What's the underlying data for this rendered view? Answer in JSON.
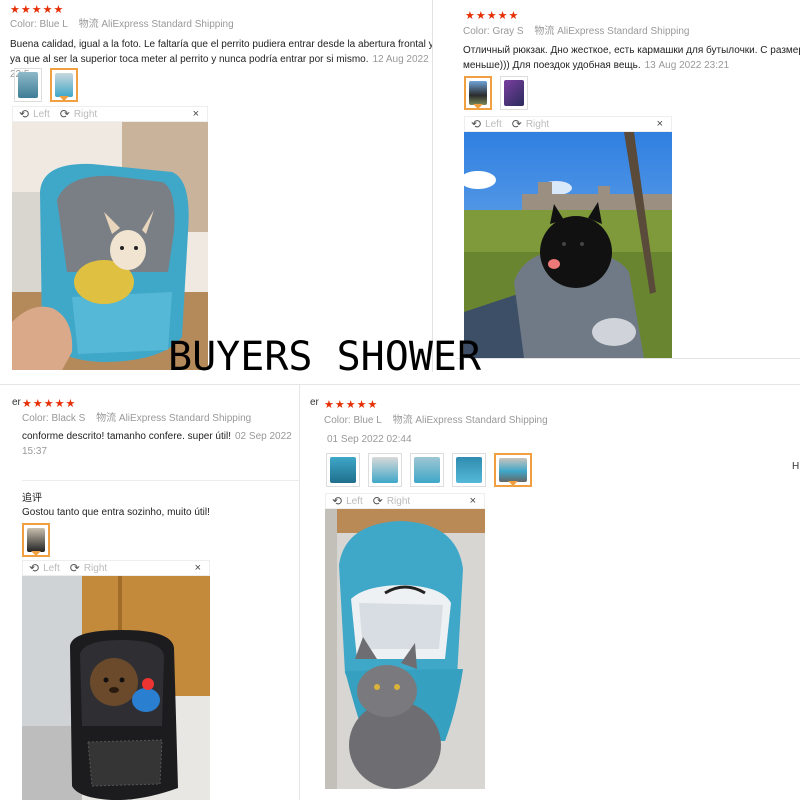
{
  "watermark": "BUYERS SHOWER",
  "rating_stars": "★★★★★",
  "viewer": {
    "rotate_left_icon": "rotate-left-icon",
    "rotate_right_icon": "rotate-right-icon",
    "left_label": "Left",
    "right_label": "Right",
    "close_label": "×"
  },
  "reviews": [
    {
      "color": "Color: Blue L",
      "shipping": "物流 AliExpress Standard Shipping",
      "text_line1": "Buena calidad, igual a la foto. Le faltaría que el perrito pudiera entrar desde la abertura frontal y no",
      "text_line2": "ya que al ser la superior toca meter al perrito y nunca podría entrar por si mismo.",
      "date": "12 Aug 2022 22:5",
      "photo_subject": "chihuahua in blue pet carrier backpack"
    },
    {
      "color": "Color: Gray S",
      "shipping": "物流 AliExpress Standard Shipping",
      "text_line1": "Отличный рюкзак. Дно жесткое, есть кармашки для бутылочки. С размер",
      "text_line2": "меньше))) Для поездок удобная вещь.",
      "date": "13 Aug 2022 23:21",
      "photo_subject": "black pomeranian in gray pet carrier backpack"
    },
    {
      "color": "Color: Black S",
      "shipping": "物流 AliExpress Standard Shipping",
      "text_line1": "conforme descrito! tamanho confere. super útil!",
      "date": "02 Sep 2022 15:37",
      "followup_title": "追评",
      "followup_text": "Gostou tanto que entra sozinho, muito útil!",
      "photo_subject": "small brown dog in black pet carrier backpack"
    },
    {
      "color": "Color: Blue L",
      "shipping": "物流 AliExpress Standard Shipping",
      "date": "01 Sep 2022 02:44",
      "photo_subject": "gray cat next to blue pet carrier backpack"
    }
  ],
  "edge_fragments": {
    "left_er_1": "er",
    "right_h": "H"
  },
  "colors": {
    "star": "#e62e04",
    "active_thumb": "#f0a040",
    "blue_bag": "#3fa7c8",
    "gray_bag": "#6f7a86"
  }
}
